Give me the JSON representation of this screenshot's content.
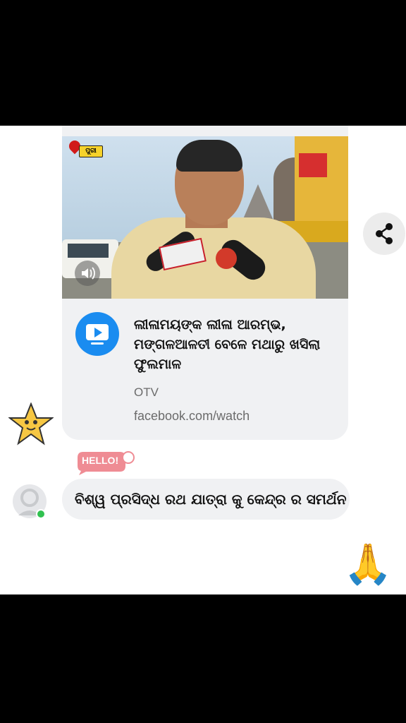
{
  "post": {
    "location_tag": "ପୁରୀ",
    "title": "ଲୀଳାମୟଙ୍କ ଲୀଳା ଆରମ୍ଭ, ମଙ୍ଗଳଆଳତୀ ବେଳେ ମଥାରୁ ଖସିଲା ଫୁଲମାଳ",
    "source": "OTV",
    "url": "facebook.com/watch"
  },
  "sticker_hello": "HELLO!",
  "comment": {
    "text": "ବିଶ୍ୱ ପ୍ରସିଦ୍ଧ ରଥ ଯାତ୍ରା କୁ କେନ୍ଦ୍ର ର ସମର୍ଥନ"
  },
  "reaction_emoji": "🙏",
  "colors": {
    "accent": "#1a8cf0",
    "online": "#31c150",
    "card_bg": "#f0f1f3"
  },
  "icons": [
    "video-play-icon",
    "share-icon",
    "speaker-icon",
    "location-pin-icon",
    "star-sticker-icon",
    "hello-sticker-icon",
    "pray-emoji-icon",
    "avatar-icon"
  ]
}
